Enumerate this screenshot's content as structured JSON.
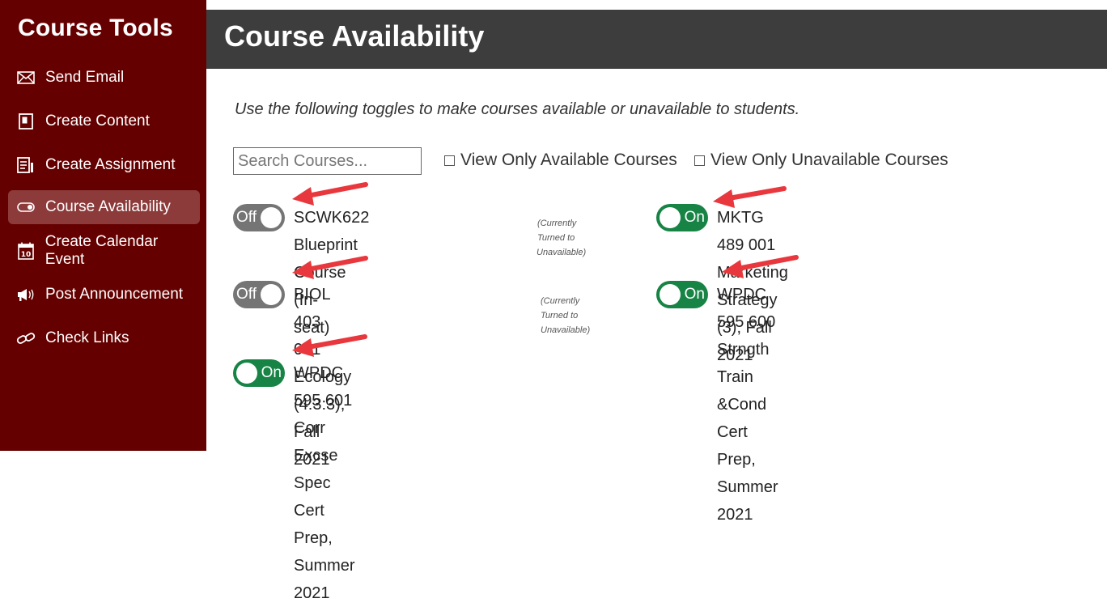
{
  "sidebar": {
    "title": "Course Tools",
    "items": [
      {
        "label": "Send Email",
        "icon": "envelope-icon"
      },
      {
        "label": "Create Content",
        "icon": "document-icon"
      },
      {
        "label": "Create Assignment",
        "icon": "assignment-icon"
      },
      {
        "label": "Course Availability",
        "icon": "toggle-icon",
        "active": true
      },
      {
        "label": "Create Calendar Event",
        "icon": "calendar-icon"
      },
      {
        "label": "Post Announcement",
        "icon": "megaphone-icon"
      },
      {
        "label": "Check Links",
        "icon": "link-icon"
      }
    ]
  },
  "header": {
    "title": "Course Availability"
  },
  "main": {
    "instructions": "Use the following toggles to make courses available or unavailable to students.",
    "search": {
      "placeholder": "Search Courses...",
      "value": ""
    },
    "filters": {
      "available_label": "View Only Available Courses",
      "unavailable_label": "View Only Unavailable Courses"
    },
    "courses": [
      {
        "state": "Off",
        "name_line1": "SCWK622 Blueprint Course (In-",
        "name_line2": "seat)",
        "status_line1": "(Currently Turned to",
        "status_line2": "Unavailable)"
      },
      {
        "state": "On",
        "name_line1": "MKTG 489 001 Marketing Strategy (3), Fall 2021",
        "name_line2": ""
      },
      {
        "state": "Off",
        "name_line1": "BIOL 403 001 Ecology (4:3:3),",
        "name_line2": "Fall 2021",
        "status_line1": "(Currently Turned to",
        "status_line2": "Unavailable)"
      },
      {
        "state": "On",
        "name_line1": "WPDC 595 600 Strngth Train &Cond Cert Prep,",
        "name_line2": "Summer 2021"
      },
      {
        "state": "On",
        "name_line1": "WPDC 595 601 Corr Excse Spec Cert Prep,",
        "name_line2": "Summer 2021"
      }
    ]
  },
  "colors": {
    "sidebar_bg": "#650000",
    "sidebar_active": "#8c3a3a",
    "header_bg": "#3d3d3d",
    "toggle_on": "#178445",
    "toggle_off": "#757575",
    "annotation_arrow": "#e8383d"
  }
}
